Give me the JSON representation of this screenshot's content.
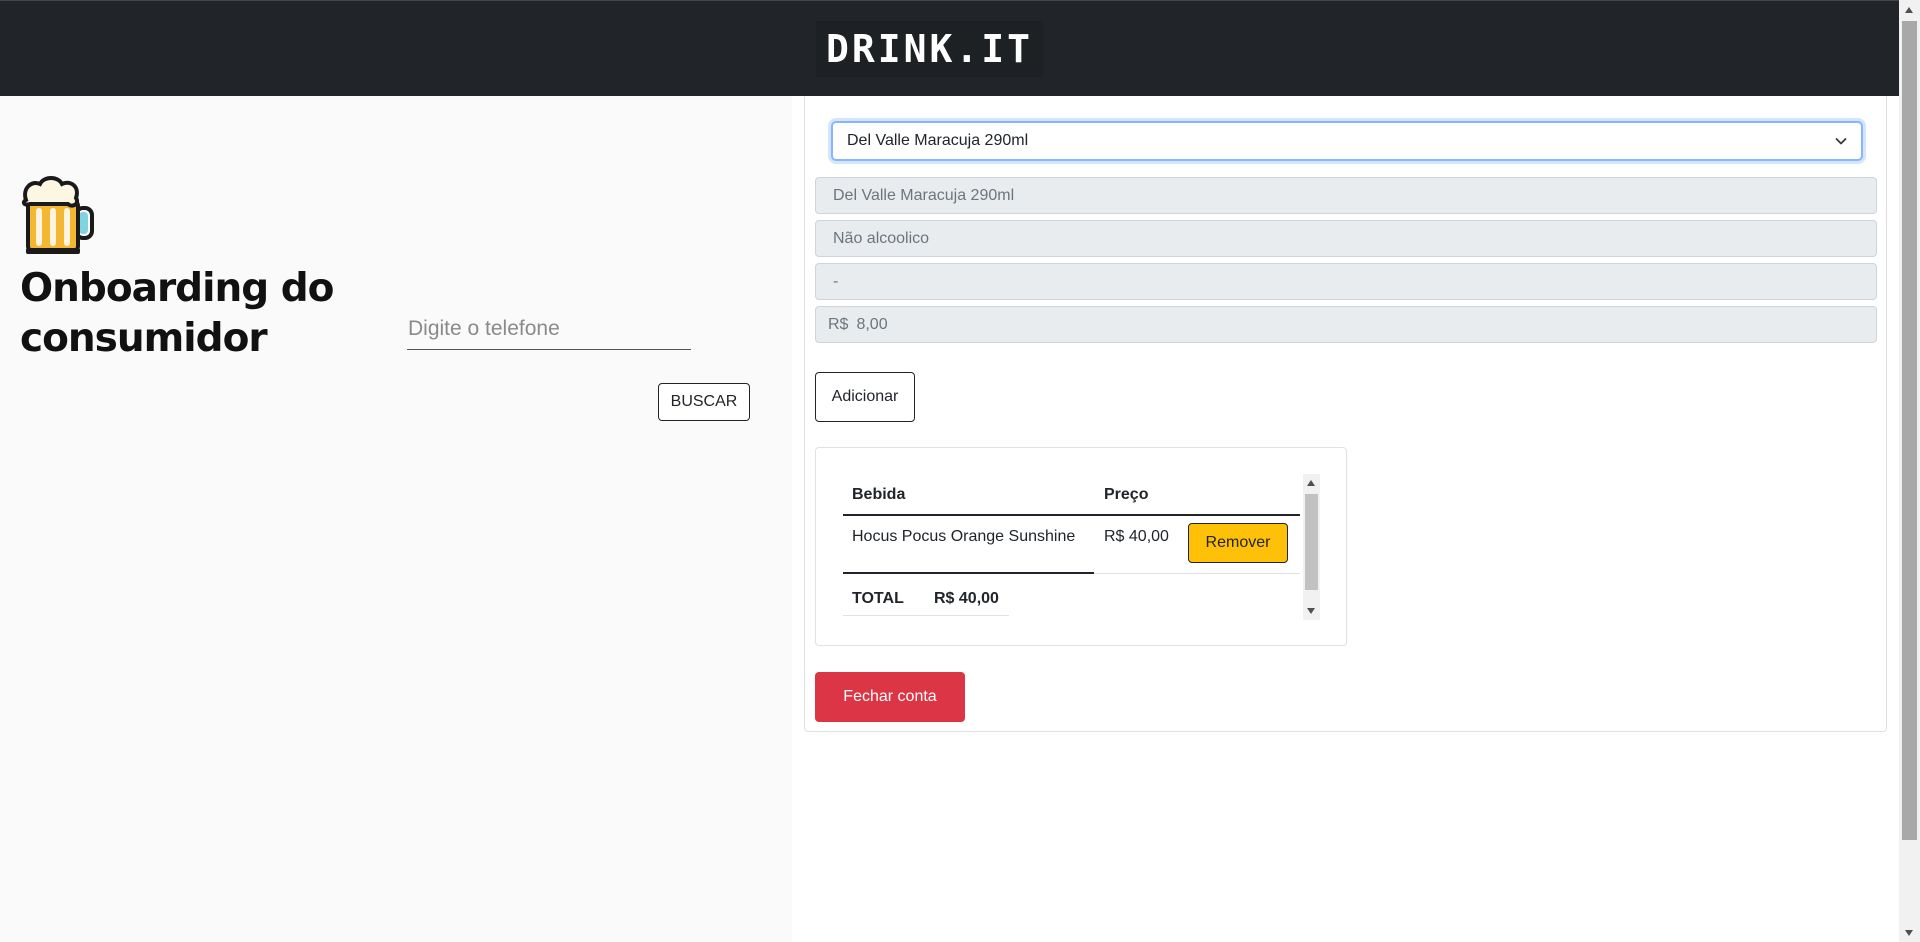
{
  "navbar": {
    "brand": "DRINK.IT"
  },
  "left_panel": {
    "icon": "beer-mug-icon",
    "title": "Onboarding do consumidor",
    "phone_placeholder": "Digite o telefone",
    "phone_value": "",
    "search_label": "BUSCAR"
  },
  "product": {
    "select_value": "Del Valle Maracuja 290ml",
    "name": "Del Valle Maracuja 290ml",
    "category": "Não alcoolico",
    "extra": "-",
    "currency": "R$",
    "price": "8,00",
    "add_label": "Adicionar"
  },
  "cart": {
    "headers": {
      "drink": "Bebida",
      "price": "Preço"
    },
    "items": [
      {
        "drink": "Hocus Pocus Orange Sunshine",
        "price": "R$ 40,00",
        "remove_label": "Remover"
      }
    ],
    "total_label": "TOTAL",
    "total_value": "R$ 40,00"
  },
  "close_account_label": "Fechar conta",
  "colors": {
    "navbar": "#212529",
    "remove_button": "#ffc107",
    "close_button": "#dc3545",
    "focus_ring": "#86b7fe"
  }
}
